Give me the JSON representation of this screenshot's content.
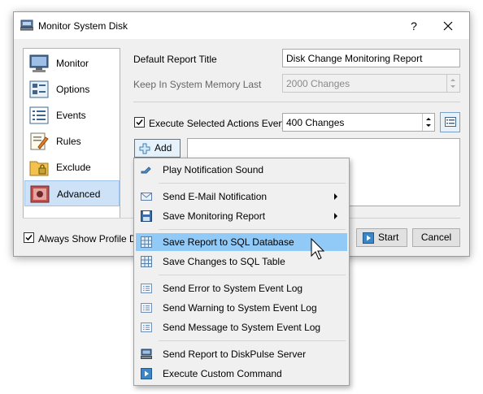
{
  "window": {
    "title": "Monitor System Disk",
    "help_label": "?"
  },
  "sidebar": {
    "items": [
      {
        "label": "Monitor",
        "icon": "monitor-icon"
      },
      {
        "label": "Options",
        "icon": "options-icon"
      },
      {
        "label": "Events",
        "icon": "events-icon"
      },
      {
        "label": "Rules",
        "icon": "rules-icon"
      },
      {
        "label": "Exclude",
        "icon": "exclude-icon"
      },
      {
        "label": "Advanced",
        "icon": "advanced-icon",
        "active": true
      }
    ]
  },
  "form": {
    "report_title_label": "Default Report Title",
    "report_title_value": "Disk Change Monitoring Report",
    "memory_label": "Keep In System Memory Last",
    "memory_value": "2000 Changes",
    "execute_label": "Execute Selected Actions Every",
    "execute_checked": true,
    "execute_value": "400 Changes",
    "add_label": "Add"
  },
  "footer": {
    "always_show_label": "Always Show Profile Dial",
    "always_show_checked": true,
    "start_label": "Start",
    "cancel_label": "Cancel"
  },
  "menu": {
    "items": [
      {
        "label": "Play Notification Sound",
        "icon": "speaker-icon"
      },
      {
        "label": "Send E-Mail Notification",
        "icon": "envelope-icon",
        "submenu": true
      },
      {
        "label": "Save Monitoring Report",
        "icon": "floppy-icon",
        "submenu": true
      },
      {
        "label": "Save Report to SQL Database",
        "icon": "table-icon",
        "highlighted": true
      },
      {
        "label": "Save Changes to SQL Table",
        "icon": "table-icon"
      },
      {
        "label": "Send Error to System Event Log",
        "icon": "log-icon"
      },
      {
        "label": "Send Warning to System Event Log",
        "icon": "log-icon"
      },
      {
        "label": "Send Message to System Event Log",
        "icon": "log-icon"
      },
      {
        "label": "Send Report to DiskPulse Server",
        "icon": "server-icon"
      },
      {
        "label": "Execute Custom Command",
        "icon": "play-icon"
      }
    ]
  },
  "colors": {
    "menu_highlight": "#91c9f7",
    "sidebar_active": "#cde1f7"
  }
}
